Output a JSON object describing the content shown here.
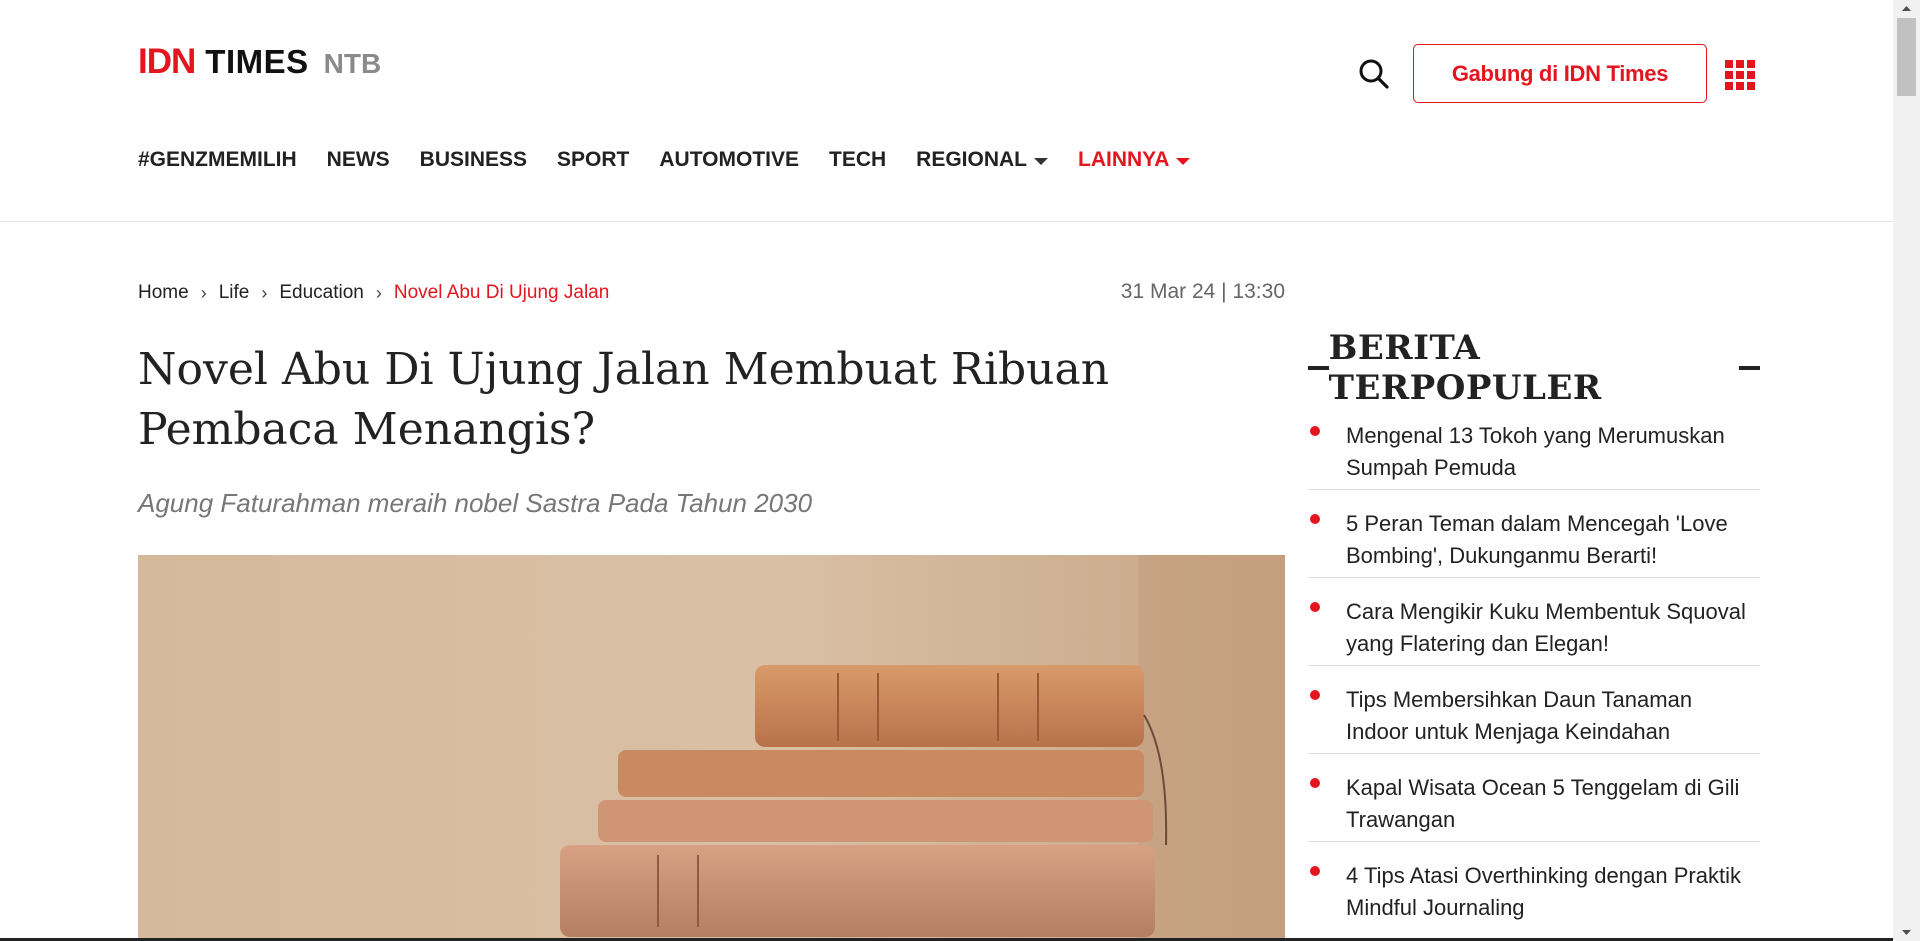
{
  "brand": {
    "idn": "IDN",
    "times": "TIMES",
    "region": "NTB"
  },
  "header": {
    "join_label": "Gabung di IDN Times"
  },
  "nav": [
    {
      "label": "#GENZMEMILIH",
      "dropdown": false,
      "active": false
    },
    {
      "label": "NEWS",
      "dropdown": false,
      "active": false
    },
    {
      "label": "BUSINESS",
      "dropdown": false,
      "active": false
    },
    {
      "label": "SPORT",
      "dropdown": false,
      "active": false
    },
    {
      "label": "AUTOMOTIVE",
      "dropdown": false,
      "active": false
    },
    {
      "label": "TECH",
      "dropdown": false,
      "active": false
    },
    {
      "label": "REGIONAL",
      "dropdown": true,
      "active": false
    },
    {
      "label": "LAINNYA",
      "dropdown": true,
      "active": true
    }
  ],
  "breadcrumb": [
    "Home",
    "Life",
    "Education",
    "Novel Abu Di Ujung Jalan"
  ],
  "article": {
    "date": "31 Mar 24 | 13:30",
    "title": "Novel Abu Di Ujung Jalan Membuat Ribuan Pembaca Menangis?",
    "subtitle": "Agung Faturahman meraih nobel Sastra Pada Tahun 2030"
  },
  "sidebar": {
    "title": "BERITA TERPOPULER",
    "items": [
      "Mengenal 13 Tokoh yang Merumuskan Sumpah Pemuda",
      "5 Peran Teman dalam Mencegah 'Love Bombing', Dukunganmu Berarti!",
      "Cara Mengikir Kuku Membentuk Squoval yang Flatering dan Elegan!",
      "Tips Membersihkan Daun Tanaman Indoor untuk Menjaga Keindahan",
      "Kapal Wisata Ocean 5 Tenggelam di Gili Trawangan",
      "4 Tips Atasi Overthinking dengan Praktik Mindful Journaling"
    ]
  },
  "colors": {
    "brand_red": "#e3151f",
    "text": "#222222",
    "muted": "#777777"
  },
  "icons": {
    "search": "search-icon",
    "apps": "apps-grid-icon",
    "caret": "caret-down-icon",
    "bullet": "bullet-dot-icon"
  }
}
